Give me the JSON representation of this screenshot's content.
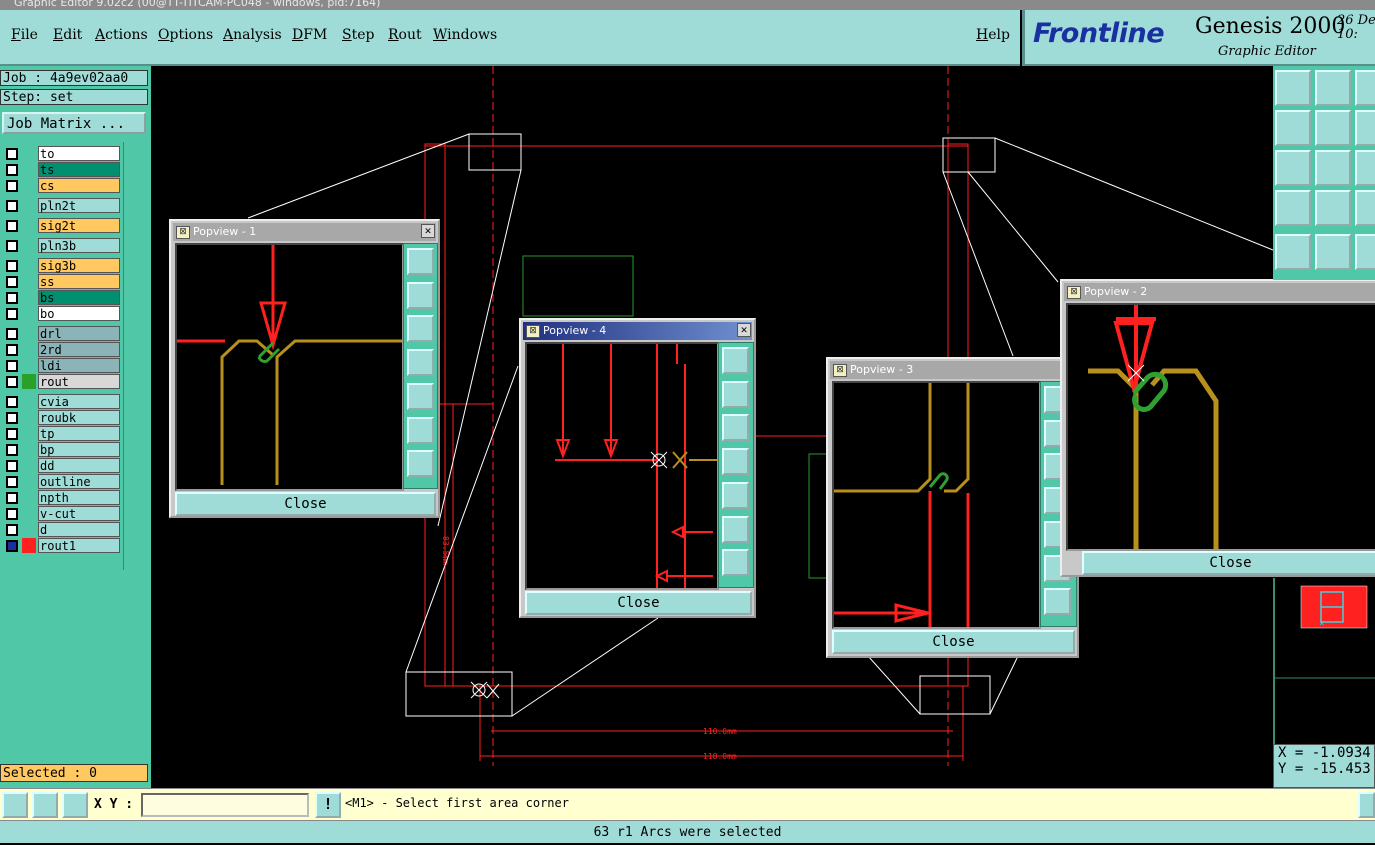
{
  "window": {
    "title": "Graphic Editor 9.02c2 (00@TT-TITCAM-PC048 - windows, pid:7164)"
  },
  "menu": {
    "file": "File",
    "edit": "Edit",
    "actions": "Actions",
    "options": "Options",
    "analysis": "Analysis",
    "dfm": "DFM",
    "step": "Step",
    "rout": "Rout",
    "windows": "Windows",
    "help": "Help"
  },
  "brand": {
    "logo": "Frontline",
    "product": "Genesis 2000",
    "subtitle": "Graphic Editor",
    "date_line1": "26 De",
    "date_line2": "10:"
  },
  "job": {
    "label": "Job : 4a9ev02aa0",
    "step": "Step: set",
    "matrix_button": "Job Matrix ..."
  },
  "layers": [
    {
      "name": "to",
      "color": "#ffffff"
    },
    {
      "name": "ts",
      "color": "#009070"
    },
    {
      "name": "cs",
      "color": "#ffc860"
    },
    {
      "name": "pln2t",
      "color": "#9fdcd8"
    },
    {
      "name": "sig2t",
      "color": "#ffc860"
    },
    {
      "name": "pln3b",
      "color": "#9fdcd8"
    },
    {
      "name": "sig3b",
      "color": "#ffc860"
    },
    {
      "name": "ss",
      "color": "#ffc860"
    },
    {
      "name": "bs",
      "color": "#009070"
    },
    {
      "name": "bo",
      "color": "#ffffff"
    },
    {
      "name": "drl",
      "color": "#8ab4b8"
    },
    {
      "name": "2rd",
      "color": "#8ab4b8"
    },
    {
      "name": "ldi",
      "color": "#8ab4b8"
    },
    {
      "name": "rout",
      "color": "#d8d8d8"
    },
    {
      "name": "cvia",
      "color": "#9fdcd8"
    },
    {
      "name": "roubk",
      "color": "#9fdcd8"
    },
    {
      "name": "tp",
      "color": "#9fdcd8"
    },
    {
      "name": "bp",
      "color": "#9fdcd8"
    },
    {
      "name": "dd",
      "color": "#9fdcd8"
    },
    {
      "name": "outline",
      "color": "#9fdcd8"
    },
    {
      "name": "npth",
      "color": "#9fdcd8"
    },
    {
      "name": "v-cut",
      "color": "#9fdcd8"
    },
    {
      "name": "d",
      "color": "#9fdcd8"
    },
    {
      "name": "rout1",
      "color": "#9fdcd8"
    }
  ],
  "selected_label": "Selected : 0",
  "canvas": {
    "dim_inner": "110.0mm",
    "dim_outer": "118.0mm",
    "dim_vertical": "83.5mm"
  },
  "popups": [
    {
      "title": "Popview - 1",
      "close_label": "Close"
    },
    {
      "title": "Popview - 2",
      "close_label": "Close"
    },
    {
      "title": "Popview - 3",
      "close_label": "Close"
    },
    {
      "title": "Popview - 4",
      "close_label": "Close"
    }
  ],
  "coords": {
    "x": "X = -1.0934",
    "y": "Y = -15.453"
  },
  "bottom": {
    "xy_label": "X Y :",
    "xy_value": "",
    "prompt": "<M1> - Select first area corner"
  },
  "status": "63 r1 Arcs were selected"
}
